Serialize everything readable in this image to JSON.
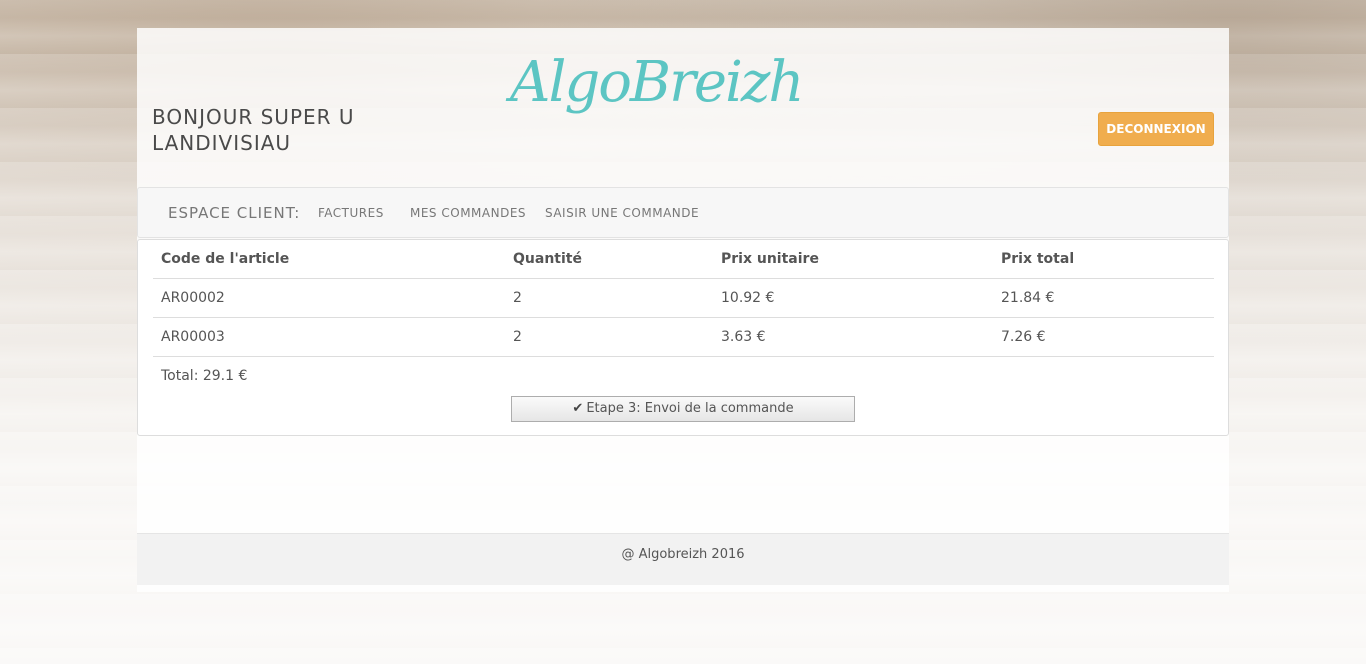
{
  "header": {
    "greeting": "BONJOUR SUPER U LANDIVISIAU",
    "logo_text": "AlgoBreizh",
    "logout_label": "DECONNEXION"
  },
  "nav": {
    "brand": "ESPACE CLIENT:",
    "items": [
      {
        "label": "FACTURES"
      },
      {
        "label": "MES COMMANDES"
      },
      {
        "label": "SAISIR UNE COMMANDE"
      }
    ]
  },
  "order": {
    "columns": [
      "Code de l'article",
      "Quantité",
      "Prix unitaire",
      "Prix total"
    ],
    "rows": [
      [
        "AR00002",
        "2",
        "10.92 €",
        "21.84 €"
      ],
      [
        "AR00003",
        "2",
        "3.63 €",
        "7.26 €"
      ]
    ],
    "total": "Total: 29.1 €",
    "step_button_label": "Etape 3: Envoi de la commande",
    "step_button_icon": "check-icon"
  },
  "footer": {
    "text": "@ Algobreizh 2016"
  },
  "colors": {
    "logo": "#5cc5c3",
    "logout_button": "#f0ad4e"
  }
}
